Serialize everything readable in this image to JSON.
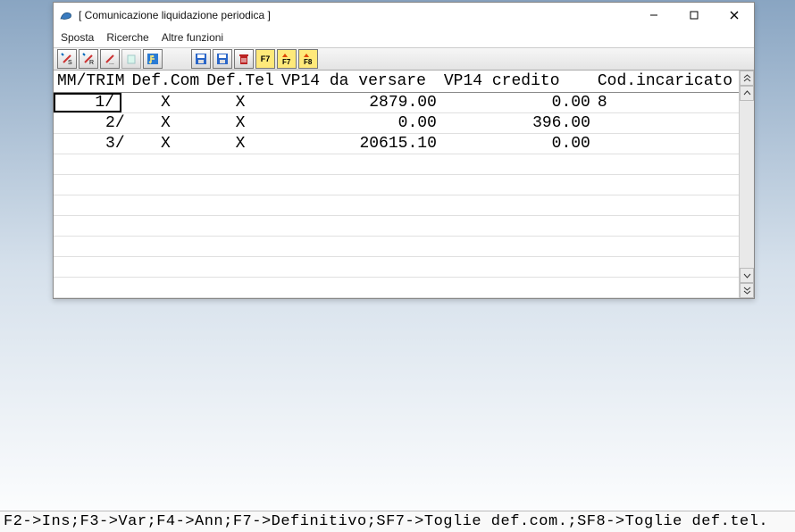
{
  "window": {
    "title": "[ Comunicazione liquidazione periodica ]"
  },
  "menu": {
    "sposta": "Sposta",
    "ricerche": "Ricerche",
    "altre_funzioni": "Altre funzioni"
  },
  "toolbar": {
    "f7": "F7",
    "f7b": "F7",
    "f8": "F8"
  },
  "grid": {
    "headers": {
      "mm": "MM/TRIM",
      "defcom": "Def.Com",
      "deftel": "Def.Tel",
      "versare": "VP14 da versare",
      "credito": "VP14 credito",
      "cod": "Cod.incaricato"
    },
    "rows": [
      {
        "mm": "1/",
        "defcom": "X",
        "deftel": "X",
        "versare": "2879.00",
        "credito": "0.00",
        "cod": "8"
      },
      {
        "mm": "2/",
        "defcom": "X",
        "deftel": "X",
        "versare": "0.00",
        "credito": "396.00",
        "cod": ""
      },
      {
        "mm": "3/",
        "defcom": "X",
        "deftel": "X",
        "versare": "20615.10",
        "credito": "0.00",
        "cod": ""
      }
    ]
  },
  "statusbar": {
    "text": "F2->Ins;F3->Var;F4->Ann;F7->Definitivo;SF7->Toglie def.com.;SF8->Toglie def.tel."
  }
}
